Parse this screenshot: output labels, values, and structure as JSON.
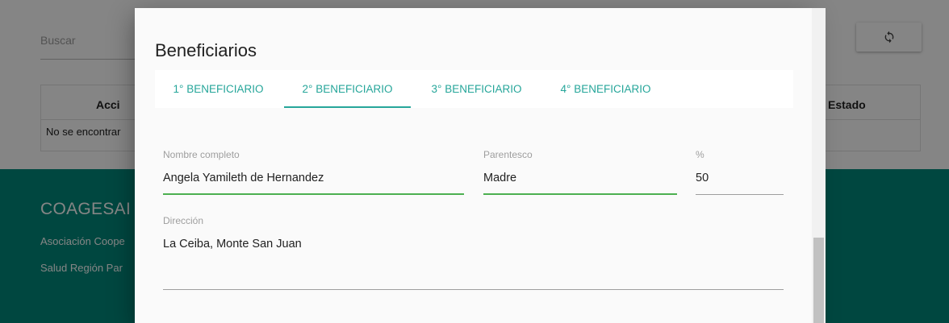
{
  "background": {
    "search": {
      "label": "Buscar"
    },
    "refresh_icon": "sync-icon",
    "table": {
      "headers": {
        "acciones": "Acci",
        "estado": "Estado"
      },
      "empty_text": "No se encontrar"
    },
    "footer": {
      "title": "COAGESAI",
      "line1": "Asociación Coope",
      "line2": "Salud Región Par"
    }
  },
  "modal": {
    "title": "Beneficiarios",
    "tabs": [
      {
        "label": "1° BENEFICIARIO"
      },
      {
        "label": "2° BENEFICIARIO",
        "active": true
      },
      {
        "label": "3° BENEFICIARIO"
      },
      {
        "label": "4° BENEFICIARIO"
      }
    ],
    "fields": {
      "nombre": {
        "label": "Nombre completo",
        "value": "Angela Yamileth de Hernandez"
      },
      "parentesco": {
        "label": "Parentesco",
        "value": "Madre"
      },
      "porcentaje": {
        "label": "%",
        "value": "50"
      },
      "direccion": {
        "label": "Dirección",
        "value": "La Ceiba, Monte San Juan"
      }
    }
  },
  "colors": {
    "accent": "#26a69a",
    "footer": "#00897b",
    "active_underline": "#4caf50"
  }
}
